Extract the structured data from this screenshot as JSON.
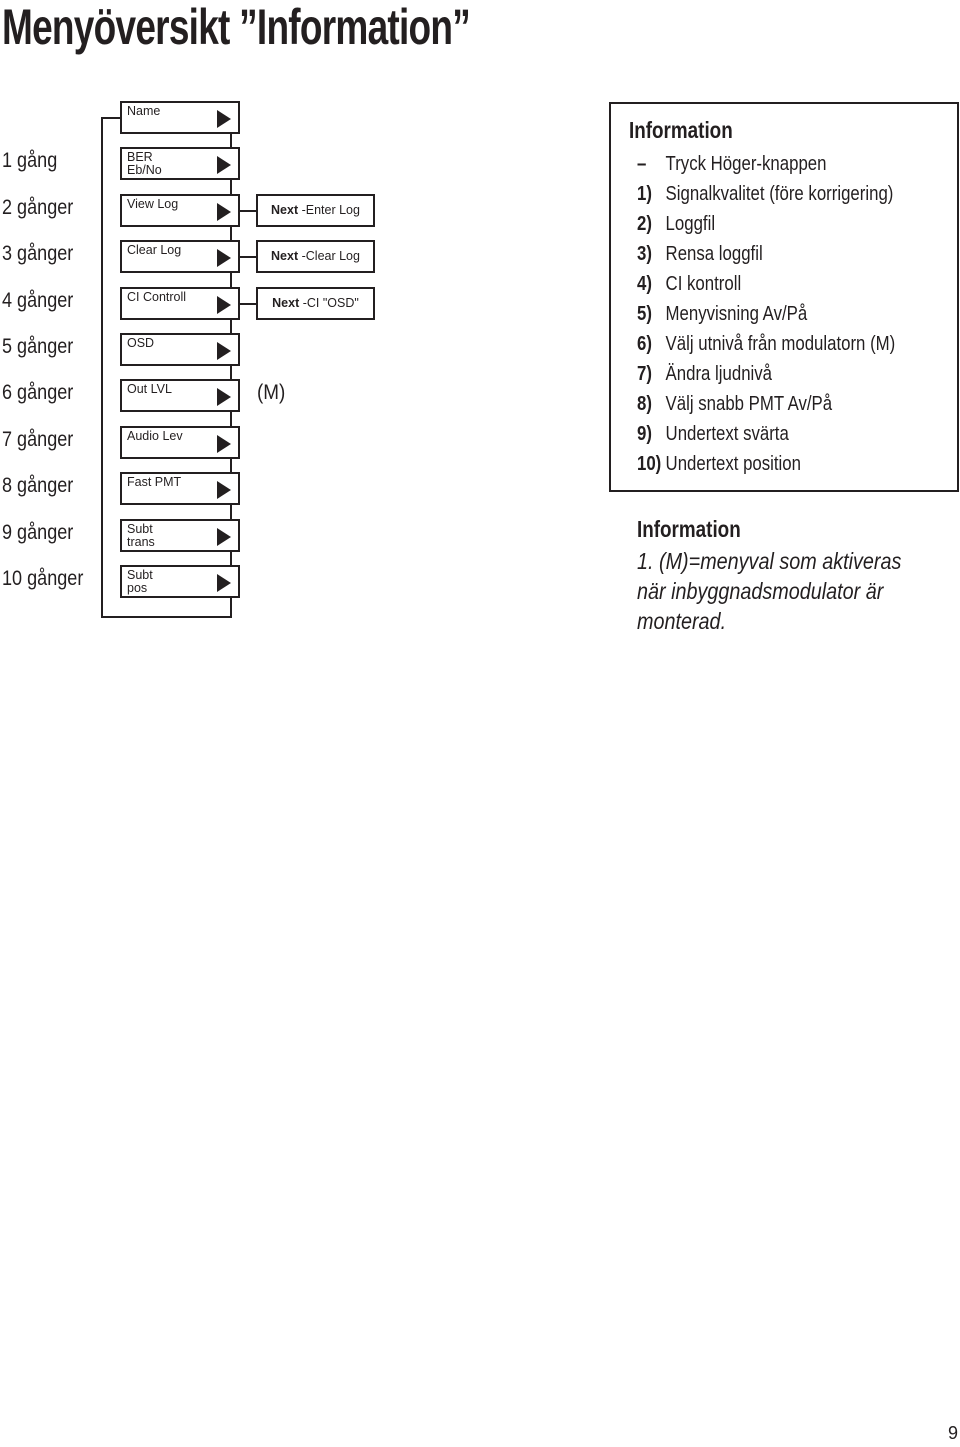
{
  "title": "Menyöversikt ”Information”",
  "press_counts": [
    "1 gång",
    "2 gånger",
    "3 gånger",
    "4 gånger",
    "5 gånger",
    "6 gånger",
    "7 gånger",
    "8 gånger",
    "9 gånger",
    "10 gånger"
  ],
  "menu_items": [
    {
      "label": "Name"
    },
    {
      "label": "BER\nEb/No"
    },
    {
      "label": "View Log"
    },
    {
      "label": "Clear Log"
    },
    {
      "label": "CI Controll"
    },
    {
      "label": "OSD"
    },
    {
      "label": "Out LVL"
    },
    {
      "label": "Audio Lev"
    },
    {
      "label": "Fast PMT"
    },
    {
      "label": "Subt\ntrans"
    },
    {
      "label": "Subt\npos"
    }
  ],
  "sub_items": [
    {
      "row": 2,
      "bold": "Next",
      "text": " -Enter Log"
    },
    {
      "row": 3,
      "bold": "Next",
      "text": " -Clear Log"
    },
    {
      "row": 4,
      "bold": "Next",
      "text": " -CI \"OSD\""
    }
  ],
  "modulator_marker": "(M)",
  "info_box": {
    "title": "Information",
    "lines": [
      {
        "num": "–",
        "text": "Tryck Höger-knappen"
      },
      {
        "num": "1)",
        "text": "Signalkvalitet (före korrigering)"
      },
      {
        "num": "2)",
        "text": "Loggfil"
      },
      {
        "num": "3)",
        "text": "Rensa loggfil"
      },
      {
        "num": "4)",
        "text": "CI kontroll"
      },
      {
        "num": "5)",
        "text": "Menyvisning Av/På"
      },
      {
        "num": "6)",
        "text": "Välj utnivå från modulatorn (M)"
      },
      {
        "num": "7)",
        "text": "Ändra ljudnivå"
      },
      {
        "num": "8)",
        "text": "Välj snabb PMT Av/På"
      },
      {
        "num": "9)",
        "text": "Undertext svärta"
      },
      {
        "num": "10)",
        "text": "Undertext position"
      }
    ]
  },
  "note": {
    "title": "Information",
    "lines": [
      "1. (M)=menyval som aktiveras",
      "när inbyggnadsmodulator är",
      "monterad."
    ]
  },
  "page_number": "9"
}
